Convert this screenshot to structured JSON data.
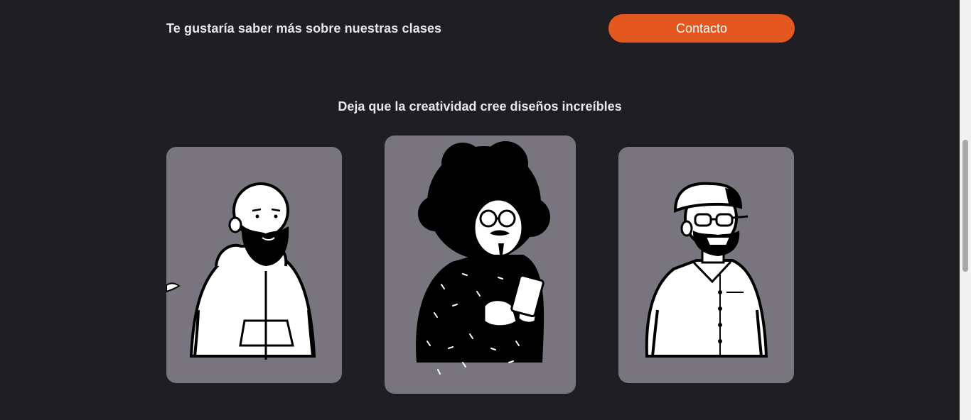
{
  "cta": {
    "text": "Te gustaría saber más sobre nuestras clases",
    "button_label": "Contacto"
  },
  "section": {
    "title": "Deja que la creatividad cree diseños increíbles"
  },
  "cards": [
    {
      "illustration": "bald-bearded-man-hoodie"
    },
    {
      "illustration": "afro-man-glasses-phone"
    },
    {
      "illustration": "beanie-man-glasses-shirt"
    }
  ],
  "colors": {
    "background": "#1f1e22",
    "accent": "#e4581f",
    "card": "#79757e",
    "text": "#e9e6ef"
  }
}
